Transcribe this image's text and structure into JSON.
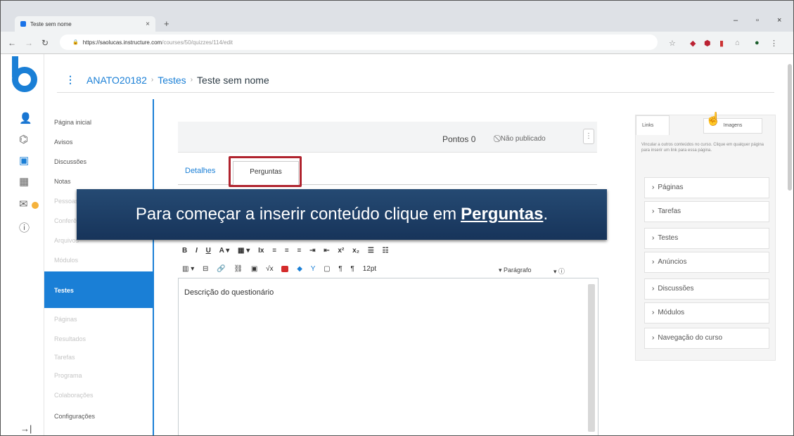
{
  "browser": {
    "tab_title": "Teste sem nome",
    "tab_close": "×",
    "new_tab": "+",
    "minimize": "–",
    "maximize": "▫",
    "close": "×",
    "url_host": "https://saolucas.instructure.com",
    "url_path": "/courses/50/quizzes/114/edit"
  },
  "breadcrumb": {
    "course": "ANATO20182",
    "section": "Testes",
    "current": "Teste sem nome",
    "separator": "›"
  },
  "course_nav": {
    "items": [
      {
        "label": "Página inicial"
      },
      {
        "label": "Avisos"
      },
      {
        "label": "Discussões"
      },
      {
        "label": "Notas"
      },
      {
        "label": "Pessoas"
      },
      {
        "label": "Conferências"
      },
      {
        "label": "Arquivos"
      },
      {
        "label": "Módulos"
      },
      {
        "label": "Testes"
      },
      {
        "label": "Páginas"
      },
      {
        "label": "Resultados"
      },
      {
        "label": "Tarefas"
      },
      {
        "label": "Programa"
      },
      {
        "label": "Colaborações"
      },
      {
        "label": "Configurações"
      }
    ]
  },
  "quiz_header": {
    "points": "Pontos 0",
    "status": "⃠ Não publicado",
    "kebab": "⋮"
  },
  "tabs": {
    "details": "Detalhes",
    "questions": "Perguntas"
  },
  "banner": {
    "text": "Para começar a inserir conteúdo clique em",
    "keyword": "Perguntas",
    "end": "."
  },
  "toolbar": {
    "row1": [
      "B",
      "I",
      "U",
      "A ▾",
      "▦ ▾",
      "Ix",
      "≡",
      "≡",
      "≡",
      "⇥",
      "⇤",
      "x²",
      "x₂",
      "☰",
      "☷"
    ],
    "row2": [
      "▥ ▾",
      "⊟",
      "🔗",
      "⛓",
      "▣",
      "√x",
      "",
      "◆",
      "Y",
      "▢",
      "¶",
      "¶"
    ],
    "font_size": "12pt",
    "paragraph": "▾  Parágrafo",
    "paragraph_caret": "▾  ⓘ"
  },
  "editor": {
    "text": "Descrição do questionário"
  },
  "sidebar": {
    "tab_links": "Links",
    "tab_images": "Imagens",
    "description": "Vincular a outros conteúdos no curso. Clique em qualquer página para inserir um link para essa página.",
    "items": [
      {
        "label": "Páginas"
      },
      {
        "label": "Tarefas"
      },
      {
        "label": "Testes"
      },
      {
        "label": "Anúncios"
      },
      {
        "label": "Discussões"
      },
      {
        "label": "Módulos"
      },
      {
        "label": "Navegação do curso"
      }
    ]
  },
  "colors": {
    "accent": "#1a7fd6",
    "highlight": "#b0232e",
    "banner": "#1f3f66"
  }
}
